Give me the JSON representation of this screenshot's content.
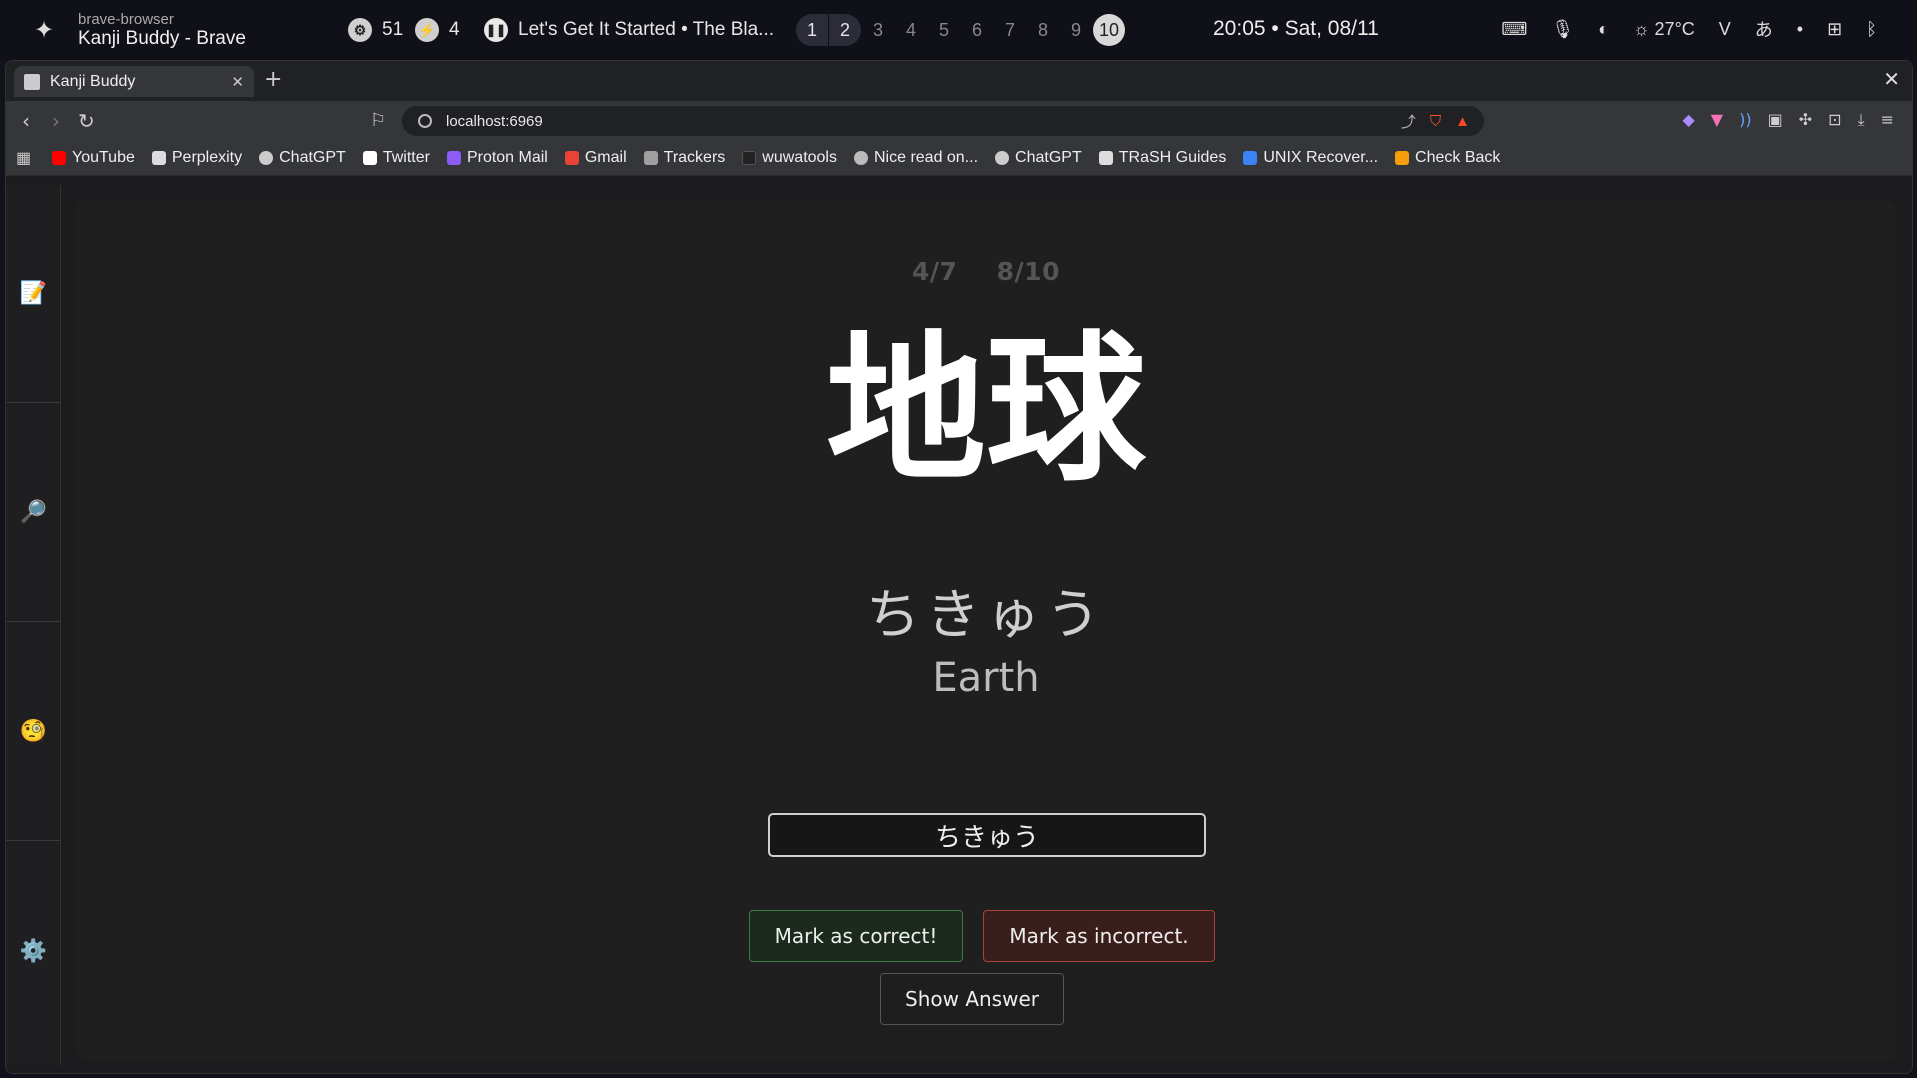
{
  "system_bar": {
    "app_sub": "brave-browser",
    "app_title": "Kanji Buddy - Brave",
    "stat1": "51",
    "stat2": "4",
    "music": "Let's Get It Started • The Bla...",
    "workspaces": [
      "1",
      "2",
      "3",
      "4",
      "5",
      "6",
      "7",
      "8",
      "9",
      "10"
    ],
    "clock": "20:05 • Sat, 08/11",
    "weather": "27°C"
  },
  "browser": {
    "tab_title": "Kanji Buddy",
    "url": "localhost:6969",
    "bookmarks": [
      {
        "label": "YouTube",
        "color": "#ff0000"
      },
      {
        "label": "Perplexity",
        "color": "#dddddd"
      },
      {
        "label": "ChatGPT",
        "color": "#cccccc"
      },
      {
        "label": "Twitter",
        "color": "#ffffff"
      },
      {
        "label": "Proton Mail",
        "color": "#8b5cf6"
      },
      {
        "label": "Gmail",
        "color": "#ea4335"
      },
      {
        "label": "Trackers",
        "color": "#a0a0a0"
      },
      {
        "label": "wuwatools",
        "color": "#222222"
      },
      {
        "label": "Nice read on...",
        "color": "#bbbbbb"
      },
      {
        "label": "ChatGPT",
        "color": "#cccccc"
      },
      {
        "label": "TRaSH Guides",
        "color": "#dddddd"
      },
      {
        "label": "UNIX Recover...",
        "color": "#3b82f6"
      },
      {
        "label": "Check Back",
        "color": "#f59e0b"
      }
    ]
  },
  "sidebar": {
    "items": [
      "📝",
      "🔎",
      "🧐",
      "⚙️"
    ]
  },
  "quiz": {
    "progress_a": "4/7",
    "progress_b": "8/10",
    "kanji": "地球",
    "reading": "ちきゅう",
    "meaning": "Earth",
    "input_value": "ちきゅう",
    "correct_label": "Mark as correct!",
    "incorrect_label": "Mark as incorrect.",
    "show_label": "Show Answer"
  }
}
